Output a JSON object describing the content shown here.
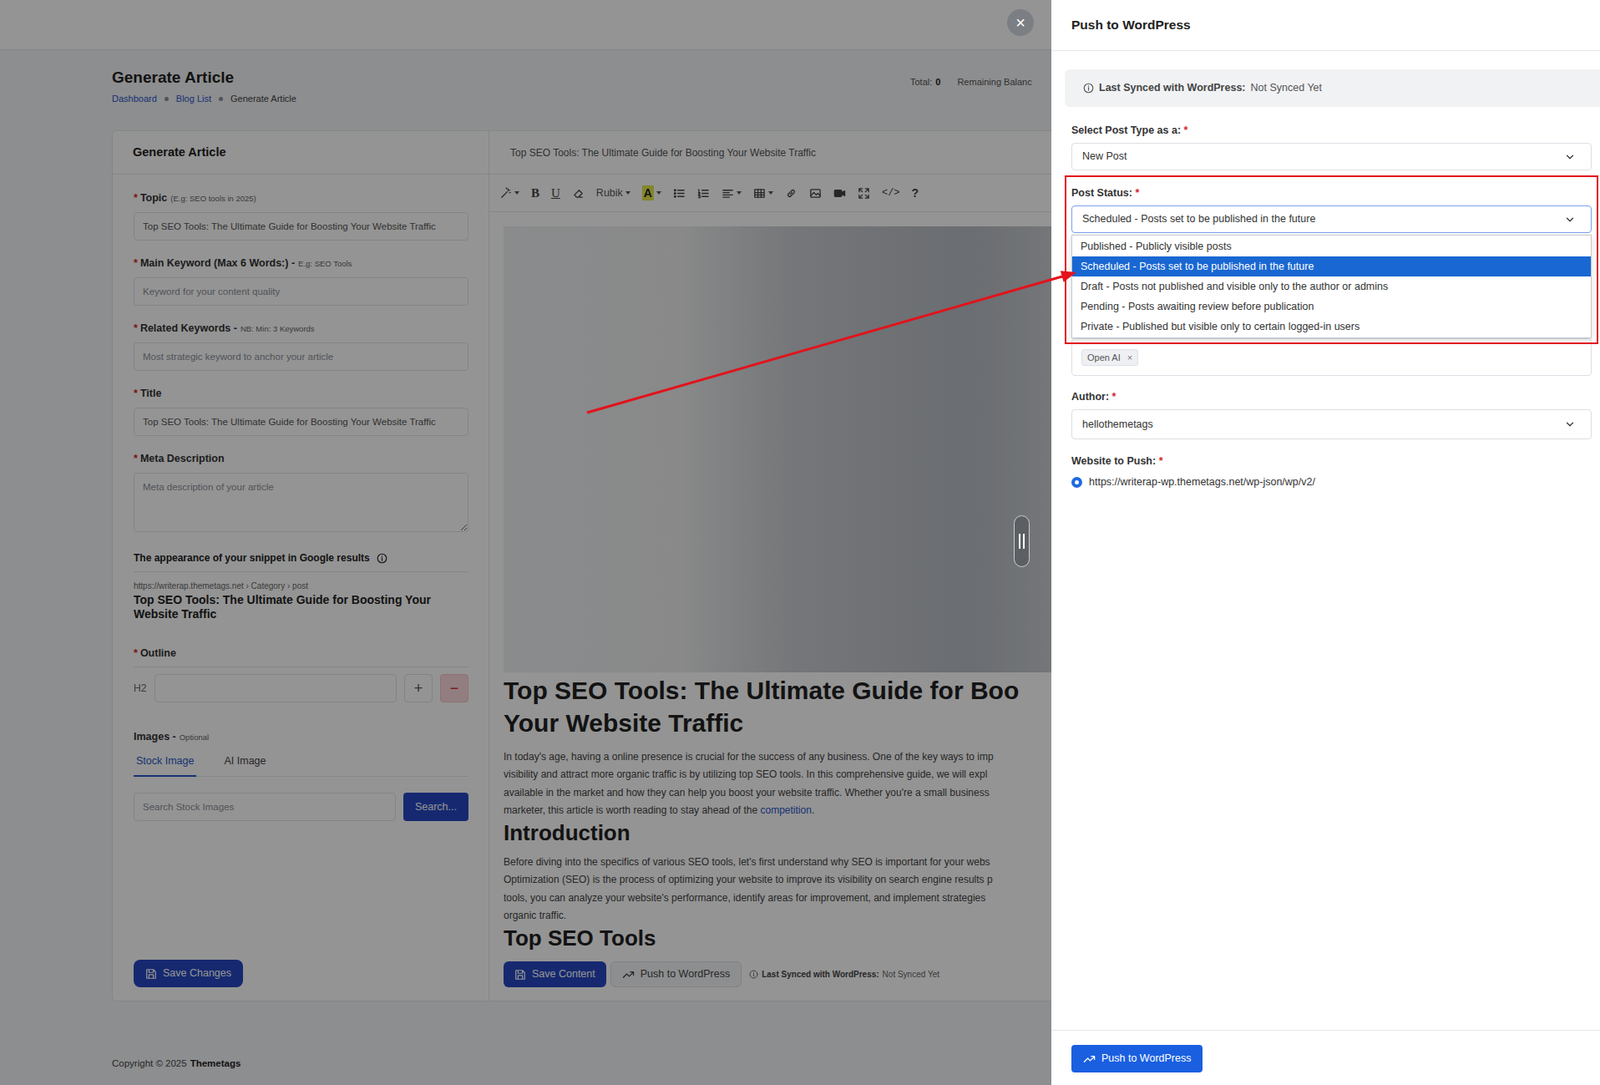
{
  "required_mark": "*",
  "page": {
    "title": "Generate Article",
    "breadcrumbs": [
      {
        "label": "Dashboard",
        "selected": false
      },
      {
        "label": "Blog List",
        "selected": false
      },
      {
        "label": "Generate Article",
        "selected": true
      }
    ],
    "stats": {
      "total_label": "Total:",
      "total_value": "0",
      "balance_label": "Remaining Balanc"
    },
    "footer": {
      "text": "Copyright © 2025",
      "brand": "Themetags"
    }
  },
  "form": {
    "header": "Generate Article",
    "fields": [
      {
        "label": "Topic",
        "hint": "(E.g: SEO tools in 2025)",
        "required": true,
        "kind": "input",
        "value": "Top SEO Tools: The Ultimate Guide for Boosting Your Website Traffic"
      },
      {
        "label": "Main Keyword (Max 6 Words:) -",
        "hint": "E.g: SEO Tools",
        "required": true,
        "kind": "input",
        "placeholder": "Keyword for your content quality"
      },
      {
        "label": "Related Keywords -",
        "hint": "NB: Min: 3 Keywords",
        "required": true,
        "kind": "input",
        "placeholder": "Most strategic keyword to anchor your article"
      },
      {
        "label": "Title",
        "required": true,
        "kind": "input",
        "value": "Top SEO Tools: The Ultimate Guide for Boosting Your Website Traffic"
      },
      {
        "label": "Meta Description",
        "required": true,
        "kind": "textarea",
        "placeholder": "Meta description of your article"
      }
    ],
    "snippet": {
      "heading": "The appearance of your snippet in Google results",
      "url": "https://writerap.themetags.net › Category › post",
      "title": "Top SEO Tools: The Ultimate Guide for Boosting Your Website Traffic"
    },
    "outline": {
      "label": "Outline",
      "required": true,
      "level": "H2",
      "add": "+",
      "remove": "−"
    },
    "images": {
      "label": "Images -",
      "hint": "Optional",
      "tabs": [
        {
          "label": "Stock Image",
          "selected": true
        },
        {
          "label": "AI Image",
          "selected": false
        }
      ],
      "search_placeholder": "Search Stock Images",
      "search_button": "Search..."
    },
    "save_button": "Save Changes"
  },
  "editor": {
    "title": "Top SEO Tools: The Ultimate Guide for Boosting Your Website Traffic",
    "toolbar": {
      "bold": "B",
      "underline": "U",
      "font": "Rubik",
      "color": "A",
      "code": "</>",
      "help": "?"
    },
    "article": [
      {
        "kind": "h1",
        "lines": [
          {
            "text": "Top SEO Tools: The Ultimate Guide for Boo"
          },
          {
            "text": "Your Website Traffic"
          }
        ]
      },
      {
        "kind": "p",
        "lines": [
          {
            "text": "In today's age, having a online presence is crucial for the success of any business. One of the key ways to imp"
          },
          {
            "text": "visibility and attract more organic traffic is by utilizing top SEO tools. In this comprehensive guide, we will expl"
          },
          {
            "text": "available in the market and how they can help you boost your website traffic. Whether you're a small business"
          },
          {
            "text": "marketer, this article is worth reading to stay ahead of the ",
            "link": "competition",
            "after": "."
          }
        ]
      },
      {
        "kind": "h2",
        "lines": [
          {
            "text": "Introduction"
          }
        ]
      },
      {
        "kind": "p",
        "lines": [
          {
            "text": "Before diving into the specifics of various SEO tools, let's first understand why SEO is important for your webs"
          },
          {
            "text": "Optimization (SEO) is the process of optimizing your website to improve its visibility on search engine results p"
          },
          {
            "text": "tools, you can analyze your website's performance, identify areas for improvement, and implement strategies"
          },
          {
            "text": "organic traffic."
          }
        ]
      },
      {
        "kind": "h2",
        "lines": [
          {
            "text": "Top SEO Tools"
          }
        ]
      }
    ],
    "actions": {
      "save": "Save Content",
      "push": "Push to WordPress",
      "sync_label": "Last Synced with WordPress:",
      "sync_value": "Not Synced Yet"
    }
  },
  "panel": {
    "title": "Push to WordPress",
    "close": "×",
    "sync_label": "Last Synced with WordPress:",
    "sync_value": "Not Synced Yet",
    "post_type": {
      "label": "Select Post Type as a:",
      "required": true,
      "value": "New Post"
    },
    "post_status": {
      "label": "Post Status:",
      "required": true,
      "value": "Scheduled - Posts set to be published in the future",
      "expanded": true,
      "options": [
        {
          "label": "Published - Publicly visible posts",
          "selected": false
        },
        {
          "label": "Scheduled - Posts set to be published in the future",
          "selected": true
        },
        {
          "label": "Draft - Posts not published and visible only to the author or admins",
          "selected": false
        },
        {
          "label": "Pending - Posts awaiting review before publication",
          "selected": false
        },
        {
          "label": "Private - Published but visible only to certain logged-in users",
          "selected": false
        }
      ]
    },
    "categories": {
      "tags": [
        {
          "label": "Open AI",
          "remove": "×"
        }
      ]
    },
    "author": {
      "label": "Author:",
      "required": true,
      "value": "hellothemetags"
    },
    "website": {
      "label": "Website to Push:",
      "required": true,
      "options": [
        {
          "label": "https://writerap-wp.themetags.net/wp-json/wp/v2/",
          "selected": true
        }
      ]
    },
    "submit": "Push to WordPress"
  }
}
